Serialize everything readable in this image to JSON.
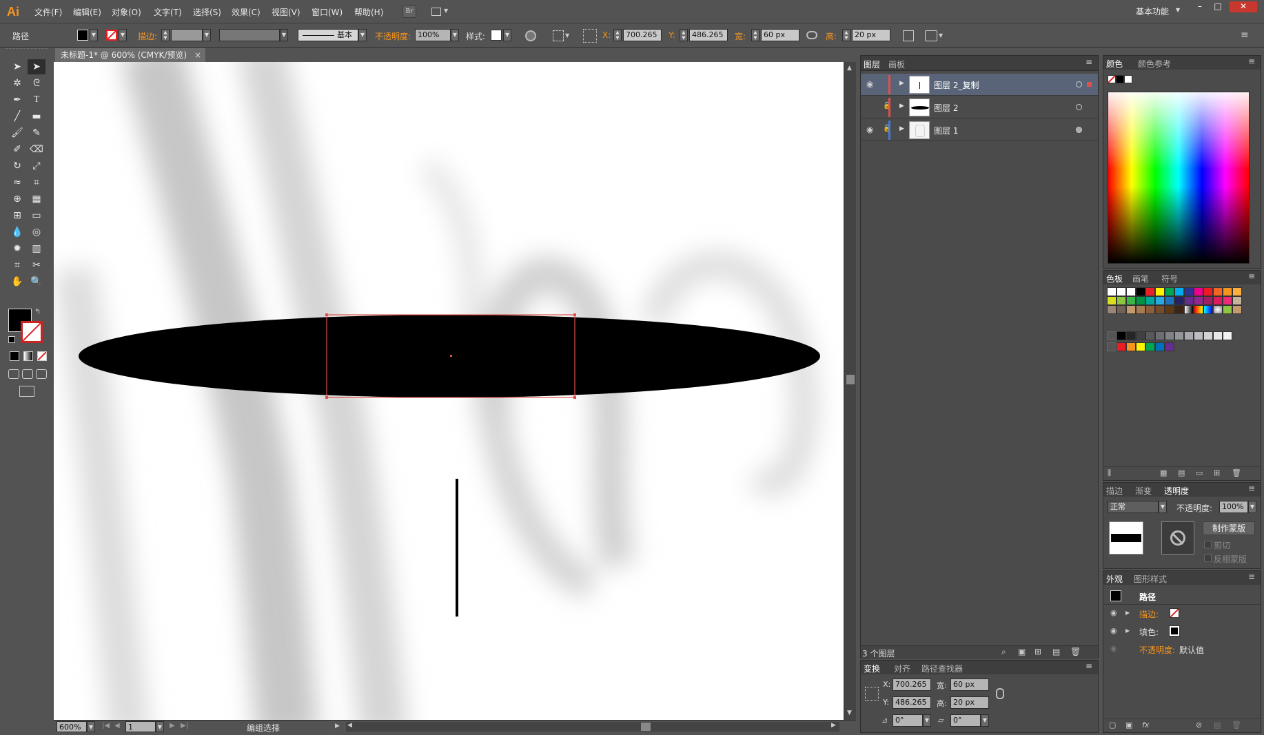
{
  "app": {
    "logo": "Ai",
    "workspace": "基本功能"
  },
  "menu": [
    "文件(F)",
    "编辑(E)",
    "对象(O)",
    "文字(T)",
    "选择(S)",
    "效果(C)",
    "视图(V)",
    "窗口(W)",
    "帮助(H)"
  ],
  "control": {
    "object_type": "路径",
    "stroke_label": "描边:",
    "brush_label": "基本",
    "opacity_label": "不透明度:",
    "opacity_value": "100%",
    "style_label": "样式:",
    "x_label": "X:",
    "x_value": "700.265",
    "y_label": "Y:",
    "y_value": "486.265",
    "w_label": "宽:",
    "w_value": "60 px",
    "h_label": "高:",
    "h_value": "20 px"
  },
  "document": {
    "tab_title": "未标题-1* @ 600% (CMYK/预览)",
    "close": "×"
  },
  "status": {
    "zoom": "600%",
    "page": "1",
    "mode": "编组选择"
  },
  "layers_panel": {
    "tabs": [
      "图层",
      "画板"
    ],
    "layers": [
      {
        "name": "图层 2_复制",
        "color": "#e0504a"
      },
      {
        "name": "图层 2",
        "color": "#e0504a"
      },
      {
        "name": "图层 1",
        "color": "#4a78d8"
      }
    ],
    "count": "3 个图层"
  },
  "transform_panel": {
    "tabs": [
      "变换",
      "对齐",
      "路径查找器"
    ],
    "x_label": "X:",
    "x": "700.265",
    "y_label": "Y:",
    "y": "486.265",
    "w_label": "宽:",
    "w": "60 px",
    "h_label": "高:",
    "h": "20 px",
    "angle": "0°",
    "shear": "0°"
  },
  "color_panel": {
    "tabs": [
      "颜色",
      "颜色参考"
    ]
  },
  "swatches_panel": {
    "tabs": [
      "色板",
      "画笔",
      "符号"
    ]
  },
  "transparency_panel": {
    "tabs": [
      "描边",
      "渐变",
      "透明度"
    ],
    "blend": "正常",
    "opacity_label": "不透明度:",
    "opacity": "100%",
    "make_mask": "制作蒙版",
    "clip": "剪切",
    "invert": "反相蒙版"
  },
  "appearance_panel": {
    "tabs": [
      "外观",
      "图形样式"
    ],
    "title": "路径",
    "stroke": "描边:",
    "fill": "填色:",
    "opacity_label": "不透明度:",
    "opacity_value": "默认值"
  },
  "colors": {
    "accent": "#f7941d",
    "selection": "#e0504a",
    "canvas": "#ffffff",
    "ui": "#535353"
  }
}
